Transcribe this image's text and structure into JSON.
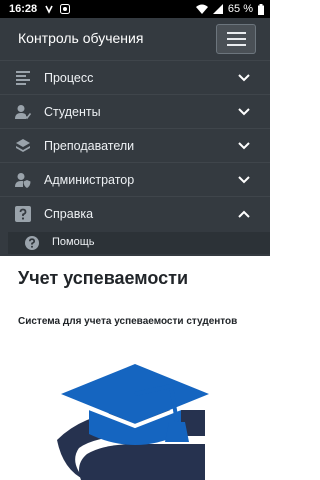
{
  "status_bar": {
    "time": "16:28",
    "battery": "65 %",
    "icons": [
      "notification-icon",
      "shield-icon",
      "wifi-icon",
      "signal-icon",
      "battery-icon"
    ]
  },
  "header": {
    "title": "Контроль обучения",
    "menu_icon": "hamburger-icon"
  },
  "menu": {
    "items": [
      {
        "label": "Процесс",
        "icon": "list-icon"
      },
      {
        "label": "Студенты",
        "icon": "user-check-icon"
      },
      {
        "label": "Преподаватели",
        "icon": "layers-icon"
      },
      {
        "label": "Администратор",
        "icon": "user-shield-icon"
      },
      {
        "label": "Справка",
        "icon": "question-square-icon"
      }
    ],
    "subitem": {
      "label": "Помощь",
      "icon": "question-circle-icon"
    }
  },
  "main": {
    "title": "Учет успеваемости",
    "subtitle": "Система для учета успеваемости студентов",
    "logo": "graduation-cap-icon"
  },
  "colors": {
    "navbar": "#343a40",
    "accent": "#1565c0",
    "book": "#26324f"
  }
}
